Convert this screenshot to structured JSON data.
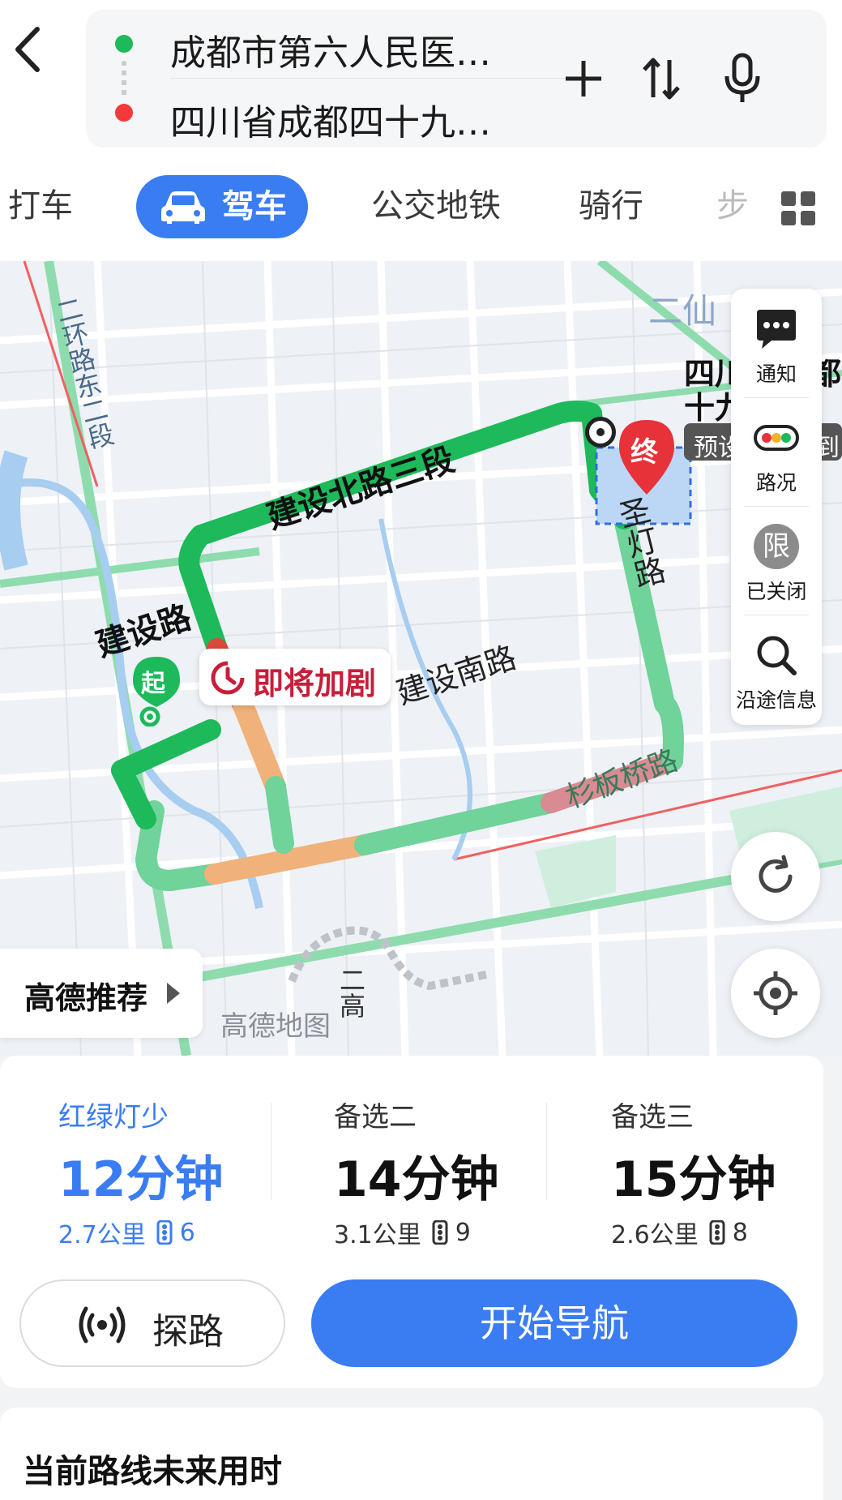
{
  "header": {
    "origin": "成都市第六人民医…",
    "destination": "四川省成都四十九…"
  },
  "tabs": {
    "taxi": "打车",
    "drive": "驾车",
    "transit": "公交地铁",
    "ride": "骑行",
    "walk_partial": "步"
  },
  "map": {
    "roads": {
      "jianshe_north3": "建设北路三段",
      "jianshe_road": "建设路",
      "jianshe_south": "建设南路",
      "shengdeng": "圣灯路",
      "shanbanqiao": "杉板桥路",
      "second_ring_east1": "二环路东二段",
      "erxian_partial": "二仙",
      "gao_partial": "二高"
    },
    "start_marker": "起",
    "end_marker": "终",
    "destination_label_line1": "四川",
    "destination_label_line1_tail": "都",
    "destination_label_line2": "十九",
    "preview_partial": "预设",
    "preview_tail": "到",
    "congestion_warning": "即将加剧",
    "recommend": "高德推荐",
    "watermark": "高德地图",
    "side_panel": {
      "notify": "通知",
      "traffic": "路况",
      "restriction_icon": "限",
      "restriction": "已关闭",
      "along_route": "沿途信息"
    },
    "colors": {
      "smooth": "#1db95a",
      "slow": "#f0b27a",
      "congested": "#d9534f",
      "light_green": "#6fd39a"
    }
  },
  "routes": [
    {
      "tag": "红绿灯少",
      "time": "12分钟",
      "distance": "2.7公里",
      "lights": "6"
    },
    {
      "tag": "备选二",
      "time": "14分钟",
      "distance": "3.1公里",
      "lights": "9"
    },
    {
      "tag": "备选三",
      "time": "15分钟",
      "distance": "2.6公里",
      "lights": "8"
    }
  ],
  "actions": {
    "explore": "探路",
    "navigate": "开始导航"
  },
  "future": {
    "title": "当前路线未来用时"
  },
  "accent_color": "#3a7cf2"
}
